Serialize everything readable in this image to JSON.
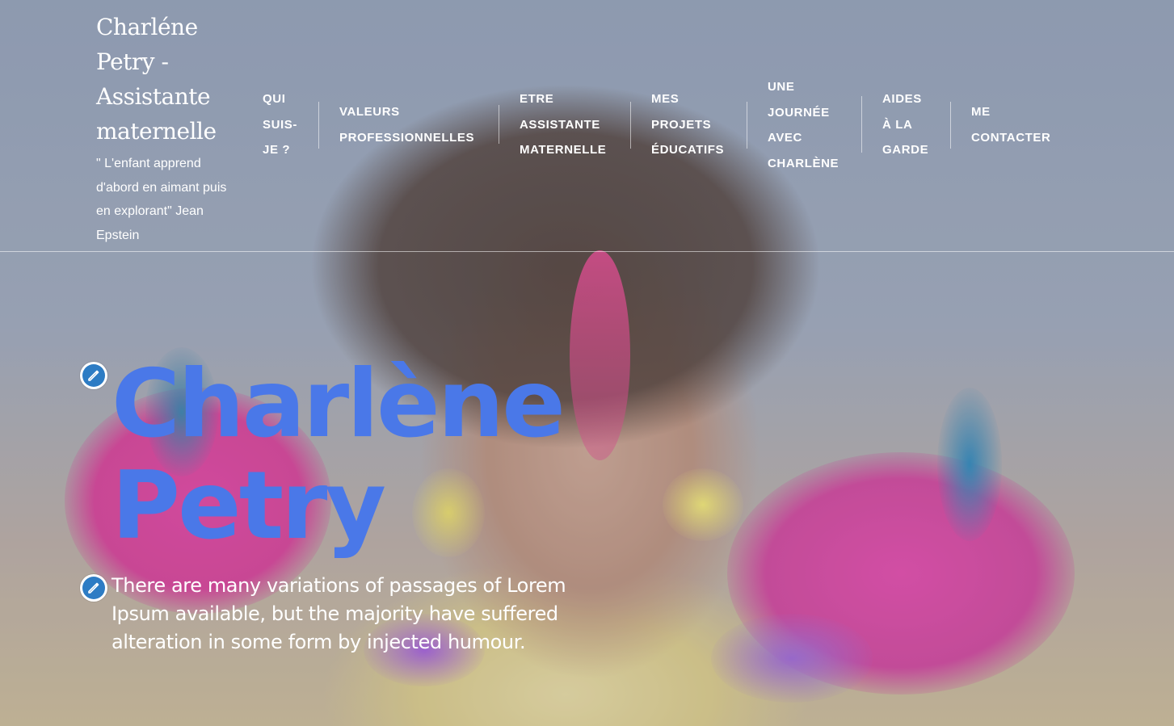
{
  "header": {
    "site_title": "Charléne Petry - Assistante maternelle",
    "tagline": "\" L'enfant apprend d'abord en aimant puis en explorant\" Jean Epstein"
  },
  "nav": {
    "items": [
      {
        "lines": [
          "QUI",
          "SUIS-",
          "JE ?"
        ]
      },
      {
        "lines": [
          "VALEURS",
          "PROFESSIONNELLES"
        ]
      },
      {
        "lines": [
          "ETRE",
          "ASSISTANTE",
          "MATERNELLE"
        ]
      },
      {
        "lines": [
          "MES",
          "PROJETS",
          "ÉDUCATIFS"
        ]
      },
      {
        "lines": [
          "UNE",
          "JOURNÉE",
          "AVEC",
          "CHARLÈNE"
        ]
      },
      {
        "lines": [
          "AIDES",
          "À LA",
          "GARDE"
        ]
      },
      {
        "lines": [
          "ME",
          "CONTACTER"
        ]
      }
    ]
  },
  "hero": {
    "title_line1": "Charlène",
    "title_line2": "Petry",
    "text": "There are many variations of passages of Lorem Ipsum available, but the majority have suffered alteration in some form by injected humour.",
    "title_color": "#4a78e8",
    "edit_icon_color": "#2d7cc4"
  }
}
